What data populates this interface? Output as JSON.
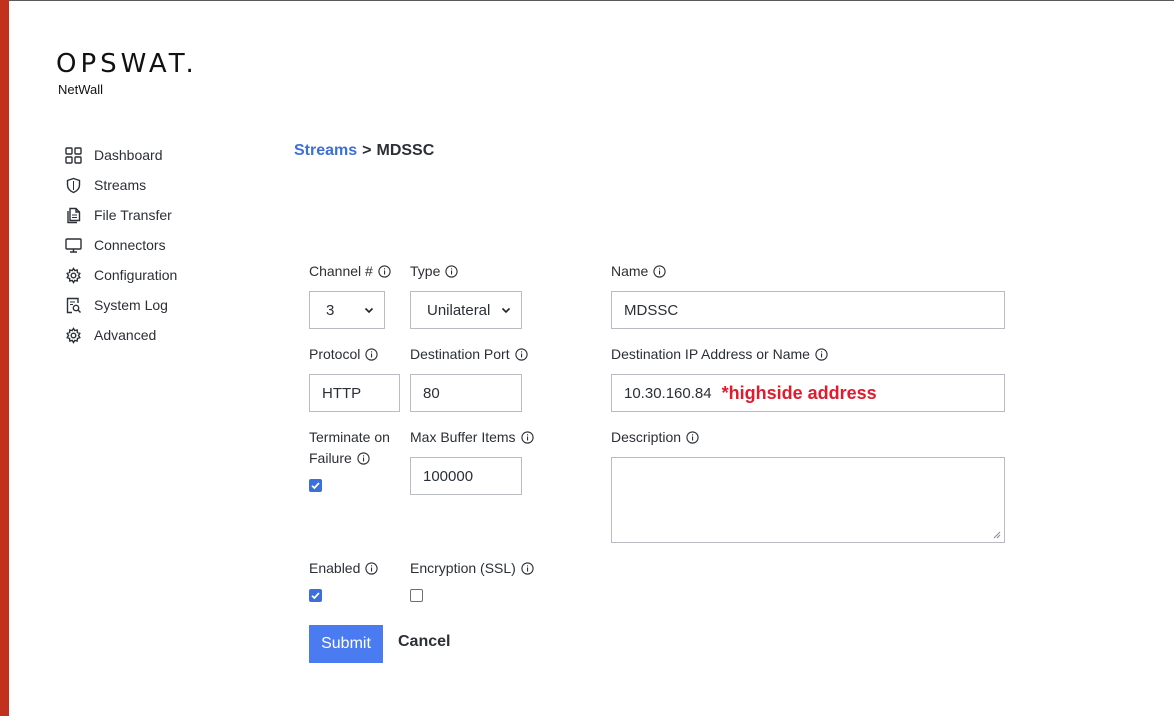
{
  "brand": {
    "logo": "OPSWAT.",
    "product": "NetWall"
  },
  "nav": {
    "items": [
      {
        "label": "Dashboard",
        "icon": "grid-icon"
      },
      {
        "label": "Streams",
        "icon": "shield-icon"
      },
      {
        "label": "File Transfer",
        "icon": "documents-icon"
      },
      {
        "label": "Connectors",
        "icon": "monitor-icon"
      },
      {
        "label": "Configuration",
        "icon": "gear-icon"
      },
      {
        "label": "System Log",
        "icon": "log-search-icon"
      },
      {
        "label": "Advanced",
        "icon": "gear-icon"
      }
    ]
  },
  "breadcrumb": {
    "parent": "Streams",
    "separator": ">",
    "current": "MDSSC"
  },
  "form": {
    "channel": {
      "label": "Channel #",
      "value": "3"
    },
    "type": {
      "label": "Type",
      "value": "Unilateral"
    },
    "name": {
      "label": "Name",
      "value": "MDSSC"
    },
    "protocol": {
      "label": "Protocol",
      "value": "HTTP"
    },
    "dest_port": {
      "label": "Destination Port",
      "value": "80"
    },
    "dest_ip": {
      "label": "Destination IP Address or Name",
      "value": "10.30.160.84",
      "annotation": "*highside address"
    },
    "terminate": {
      "label_line1": "Terminate on",
      "label_line2": "Failure",
      "checked": true
    },
    "max_buffer": {
      "label": "Max Buffer Items",
      "value": "100000"
    },
    "description": {
      "label": "Description",
      "value": ""
    },
    "enabled": {
      "label": "Enabled",
      "checked": true
    },
    "encryption": {
      "label": "Encryption (SSL)",
      "checked": false
    }
  },
  "actions": {
    "submit": "Submit",
    "cancel": "Cancel"
  },
  "colors": {
    "accent": "#3d6fdb",
    "button": "#4a7bf0",
    "brand_bar": "#c1311d",
    "annotation": "#e21a2c"
  }
}
